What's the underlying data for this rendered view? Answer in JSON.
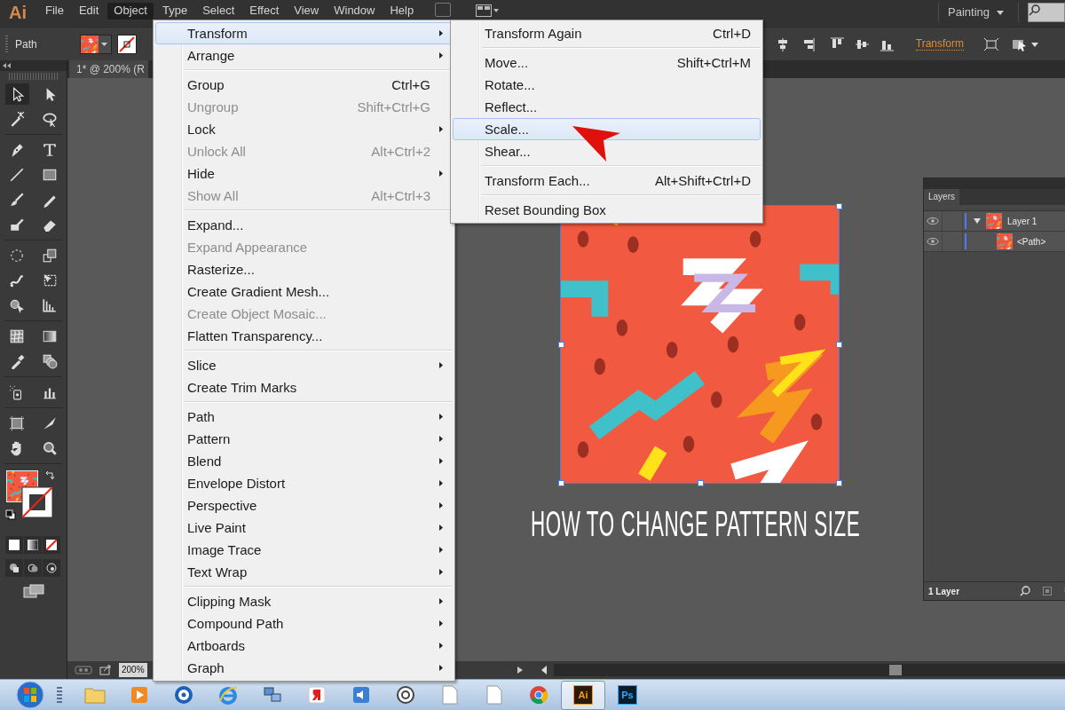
{
  "app_bar": {
    "logo": "Ai",
    "menus": [
      {
        "label": "File",
        "selected": false
      },
      {
        "label": "Edit",
        "selected": false
      },
      {
        "label": "Object",
        "selected": true
      },
      {
        "label": "Type",
        "selected": false
      },
      {
        "label": "Select",
        "selected": false
      },
      {
        "label": "Effect",
        "selected": false
      },
      {
        "label": "View",
        "selected": false
      },
      {
        "label": "Window",
        "selected": false
      },
      {
        "label": "Help",
        "selected": false
      }
    ],
    "workspace": "Painting"
  },
  "control_bar": {
    "selection_label": "Path",
    "transform_link": "Transform"
  },
  "document_tab": {
    "title": "1* @ 200% (R"
  },
  "object_menu": {
    "groups": [
      [
        {
          "label": "Transform",
          "submenu": true,
          "disabled": false,
          "selected": true
        },
        {
          "label": "Arrange",
          "submenu": true,
          "disabled": false,
          "selected": false
        }
      ],
      [
        {
          "label": "Group",
          "shortcut": "Ctrl+G",
          "submenu": false,
          "disabled": false,
          "selected": false
        },
        {
          "label": "Ungroup",
          "shortcut": "Shift+Ctrl+G",
          "submenu": false,
          "disabled": true,
          "selected": false
        },
        {
          "label": "Lock",
          "submenu": true,
          "disabled": false,
          "selected": false
        },
        {
          "label": "Unlock All",
          "shortcut": "Alt+Ctrl+2",
          "submenu": false,
          "disabled": true,
          "selected": false
        },
        {
          "label": "Hide",
          "submenu": true,
          "disabled": false,
          "selected": false
        },
        {
          "label": "Show All",
          "shortcut": "Alt+Ctrl+3",
          "submenu": false,
          "disabled": true,
          "selected": false
        }
      ],
      [
        {
          "label": "Expand...",
          "submenu": false,
          "disabled": false,
          "selected": false
        },
        {
          "label": "Expand Appearance",
          "submenu": false,
          "disabled": true,
          "selected": false
        },
        {
          "label": "Rasterize...",
          "submenu": false,
          "disabled": false,
          "selected": false
        },
        {
          "label": "Create Gradient Mesh...",
          "submenu": false,
          "disabled": false,
          "selected": false
        },
        {
          "label": "Create Object Mosaic...",
          "submenu": false,
          "disabled": true,
          "selected": false
        },
        {
          "label": "Flatten Transparency...",
          "submenu": false,
          "disabled": false,
          "selected": false
        }
      ],
      [
        {
          "label": "Slice",
          "submenu": true,
          "disabled": false,
          "selected": false
        },
        {
          "label": "Create Trim Marks",
          "submenu": false,
          "disabled": false,
          "selected": false
        }
      ],
      [
        {
          "label": "Path",
          "submenu": true,
          "disabled": false,
          "selected": false
        },
        {
          "label": "Pattern",
          "submenu": true,
          "disabled": false,
          "selected": false
        },
        {
          "label": "Blend",
          "submenu": true,
          "disabled": false,
          "selected": false
        },
        {
          "label": "Envelope Distort",
          "submenu": true,
          "disabled": false,
          "selected": false
        },
        {
          "label": "Perspective",
          "submenu": true,
          "disabled": false,
          "selected": false
        },
        {
          "label": "Live Paint",
          "submenu": true,
          "disabled": false,
          "selected": false
        },
        {
          "label": "Image Trace",
          "submenu": true,
          "disabled": false,
          "selected": false
        },
        {
          "label": "Text Wrap",
          "submenu": true,
          "disabled": false,
          "selected": false
        }
      ],
      [
        {
          "label": "Clipping Mask",
          "submenu": true,
          "disabled": false,
          "selected": false
        },
        {
          "label": "Compound Path",
          "submenu": true,
          "disabled": false,
          "selected": false
        },
        {
          "label": "Artboards",
          "submenu": true,
          "disabled": false,
          "selected": false
        },
        {
          "label": "Graph",
          "submenu": true,
          "disabled": false,
          "selected": false
        }
      ]
    ]
  },
  "transform_submenu": {
    "groups": [
      [
        {
          "label": "Transform Again",
          "shortcut": "Ctrl+D",
          "selected": false
        }
      ],
      [
        {
          "label": "Move...",
          "shortcut": "Shift+Ctrl+M",
          "selected": false
        },
        {
          "label": "Rotate...",
          "selected": false
        },
        {
          "label": "Reflect...",
          "selected": false
        },
        {
          "label": "Scale...",
          "selected": true
        },
        {
          "label": "Shear...",
          "selected": false
        }
      ],
      [
        {
          "label": "Transform Each...",
          "shortcut": "Alt+Shift+Ctrl+D",
          "selected": false
        }
      ],
      [
        {
          "label": "Reset Bounding Box",
          "selected": false
        }
      ]
    ]
  },
  "artboard": {
    "caption": "HOW TO CHANGE PATTERN SIZE",
    "selected": true
  },
  "layers_panel": {
    "tab": "Layers",
    "layers": [
      {
        "name": "Layer 1",
        "visible": true,
        "expanded": true,
        "children": [
          {
            "name": "<Path>",
            "visible": true
          }
        ]
      }
    ],
    "footer": "1 Layer"
  },
  "status_bar": {
    "zoom": "200%"
  },
  "taskbar": {
    "apps": [
      {
        "kind": "folder",
        "active": false
      },
      {
        "kind": "player",
        "active": false
      },
      {
        "kind": "disc",
        "active": false
      },
      {
        "kind": "browser-e",
        "active": false
      },
      {
        "kind": "network",
        "active": false
      },
      {
        "kind": "red-app",
        "active": false
      },
      {
        "kind": "speaker",
        "active": false
      },
      {
        "kind": "ring",
        "active": false
      },
      {
        "kind": "document",
        "active": false
      },
      {
        "kind": "document",
        "active": false
      },
      {
        "kind": "chrome",
        "active": false
      },
      {
        "kind": "badge",
        "label": "Ai",
        "active": true
      },
      {
        "kind": "badge",
        "label": "Ps",
        "active": false
      }
    ]
  }
}
